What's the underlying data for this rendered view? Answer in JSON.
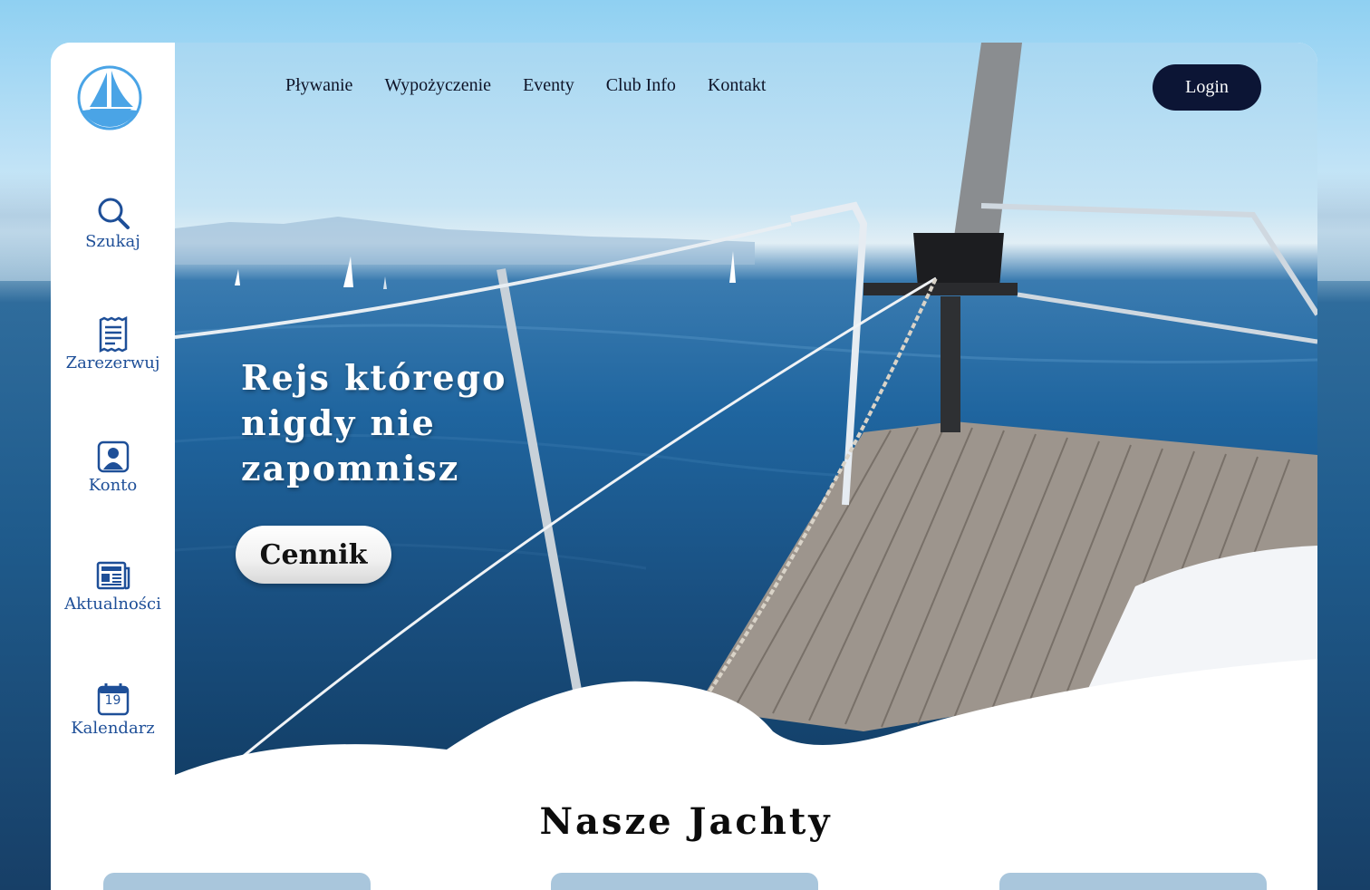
{
  "sidebar": {
    "items": [
      {
        "label": "Szukaj"
      },
      {
        "label": "Zarezerwuj"
      },
      {
        "label": "Konto"
      },
      {
        "label": "Aktualności"
      },
      {
        "label": "Kalendarz",
        "calendar_day": "19"
      }
    ]
  },
  "nav": {
    "links": [
      "Pływanie",
      "Wypożyczenie",
      "Eventy",
      "Club Info",
      "Kontakt"
    ],
    "login_label": "Login"
  },
  "hero": {
    "headline_lines": [
      "Rejs którego",
      "nigdy nie",
      "zapomnisz"
    ],
    "cta_label": "Cennik"
  },
  "yachts": {
    "title": "Nasze Jachty"
  },
  "colors": {
    "brand_blue": "#1e4f98",
    "login_bg": "#0c1535",
    "logo_blue": "#4aa4e6"
  }
}
